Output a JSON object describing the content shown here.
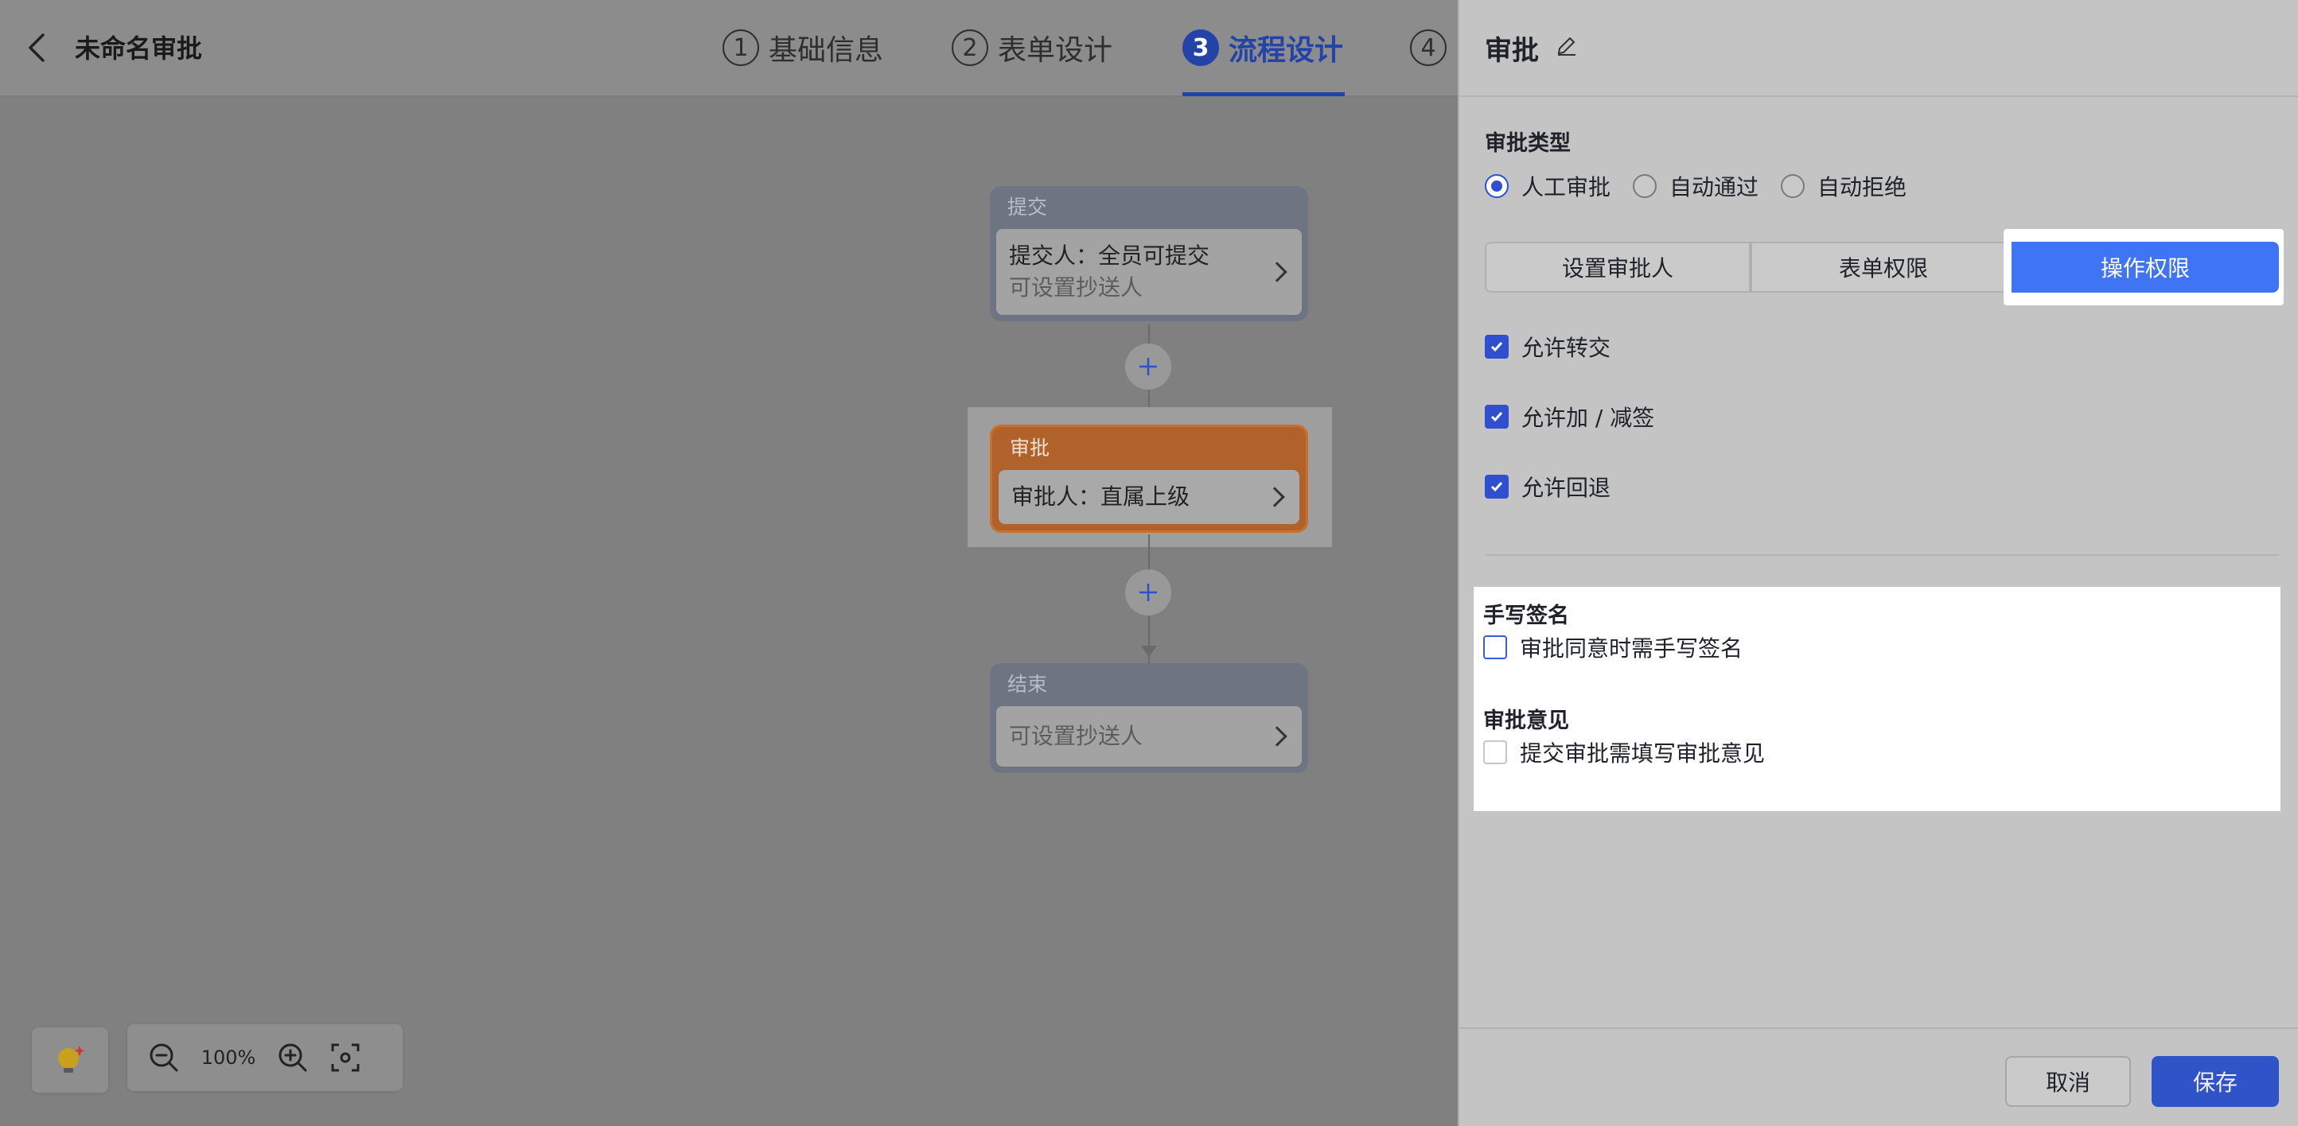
{
  "header": {
    "title": "未命名审批",
    "steps": [
      {
        "num": "1",
        "label": "基础信息"
      },
      {
        "num": "2",
        "label": "表单设计"
      },
      {
        "num": "3",
        "label": "流程设计"
      },
      {
        "num": "4",
        "label": ""
      }
    ],
    "active_step": 3
  },
  "flow": {
    "submit": {
      "head": "提交",
      "line1": "提交人：全员可提交",
      "line2": "可设置抄送人"
    },
    "approve": {
      "head": "审批",
      "line1": "审批人：直属上级"
    },
    "end": {
      "head": "结束",
      "line1": "可设置抄送人"
    }
  },
  "zoom": {
    "percent": "100%"
  },
  "panel": {
    "title": "审批",
    "approval_type_label": "审批类型",
    "approval_types": [
      {
        "label": "人工审批",
        "checked": true
      },
      {
        "label": "自动通过",
        "checked": false
      },
      {
        "label": "自动拒绝",
        "checked": false
      }
    ],
    "tabs": [
      "设置审批人",
      "表单权限",
      "操作权限"
    ],
    "active_tab": 2,
    "permissions": [
      {
        "label": "允许转交",
        "checked": true
      },
      {
        "label": "允许加 / 减签",
        "checked": true
      },
      {
        "label": "允许回退",
        "checked": true
      }
    ],
    "signature": {
      "label": "手写签名",
      "option": "审批同意时需手写签名",
      "checked": false
    },
    "opinion": {
      "label": "审批意见",
      "option": "提交审批需填写审批意见",
      "checked": false
    },
    "cancel_label": "取消",
    "save_label": "保存"
  },
  "colors": {
    "accent": "#3f74f5",
    "primary": "#2f4fd0",
    "approve_node": "#b0622a"
  }
}
